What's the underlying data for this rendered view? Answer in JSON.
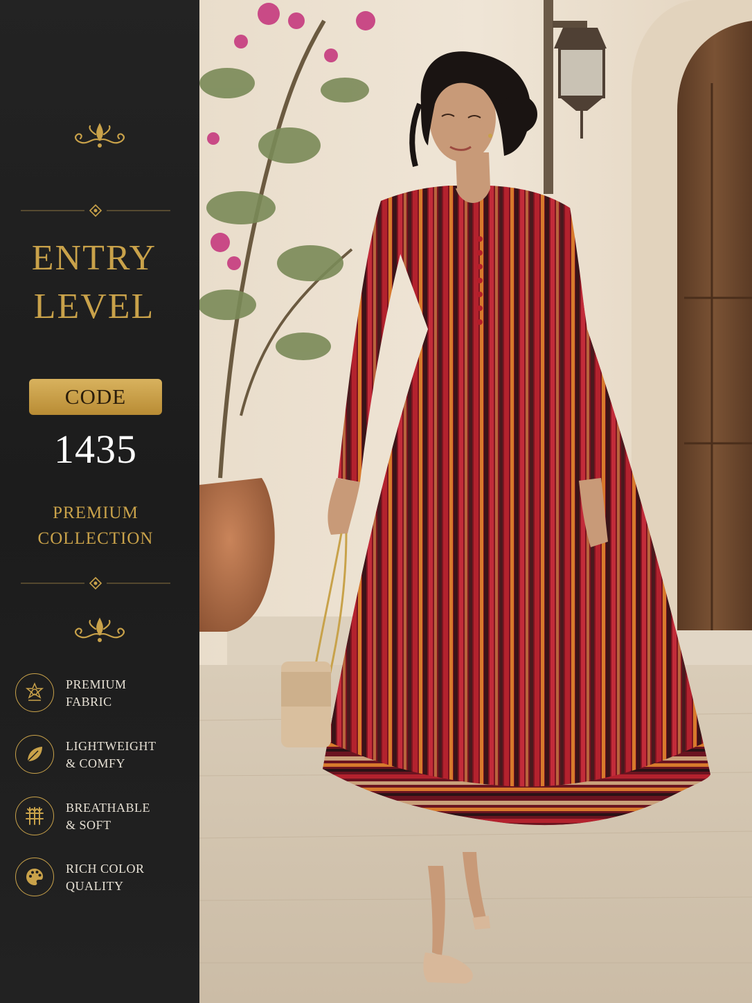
{
  "title_lines": [
    "ENTRY",
    "LEVEL"
  ],
  "code_label": "CODE",
  "code_number": "1435",
  "subtitle_lines": [
    "PREMIUM",
    "COLLECTION"
  ],
  "features": [
    {
      "line1": "PREMIUM",
      "line2": "FABRIC",
      "icon": "star-emblem-icon"
    },
    {
      "line1": "LIGHTWEIGHT",
      "line2": "& COMFY",
      "icon": "leaf-icon"
    },
    {
      "line1": "BREATHABLE",
      "line2": "& SOFT",
      "icon": "weave-icon"
    },
    {
      "line1": "RICH COLOR",
      "line2": "QUALITY",
      "icon": "palette-icon"
    }
  ],
  "colors": {
    "accent_gold": "#c9a24a",
    "panel_bg": "#1e1e1e",
    "dress_red": "#9c1c26",
    "dress_orange": "#d4782a"
  }
}
